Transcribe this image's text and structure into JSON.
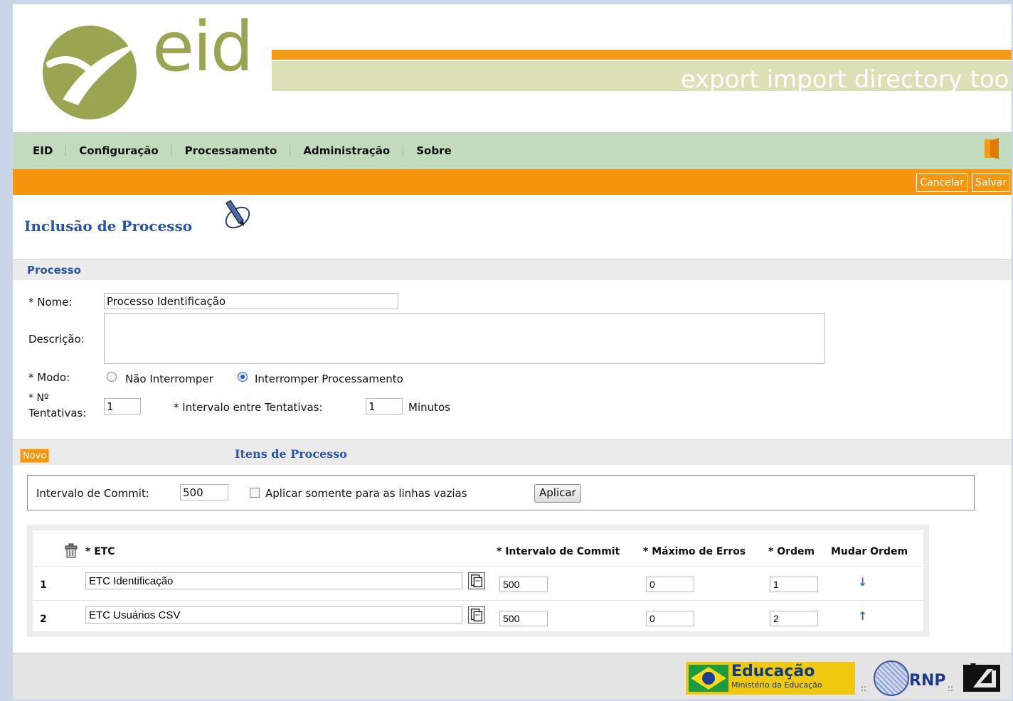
{
  "header": {
    "logo_text": "eid",
    "tagline": "export import directory tool"
  },
  "menu": {
    "items": [
      "EID",
      "Configuração",
      "Processamento",
      "Administração",
      "Sobre"
    ]
  },
  "actions": {
    "cancel_label": "Cancelar",
    "save_label": "Salvar"
  },
  "page": {
    "title": "Inclusão de Processo"
  },
  "processo_section": {
    "title": "Processo",
    "nome_label": "* Nome:",
    "nome_value": "Processo Identificação",
    "descricao_label": "Descrição:",
    "descricao_value": "",
    "modo_label": "* Modo:",
    "modo_options": [
      "Não Interromper",
      "Interromper Processamento"
    ],
    "modo_selected": "Interromper Processamento",
    "tentativas_label_1": "* Nº",
    "tentativas_label_2": "Tentativas:",
    "tentativas_value": "1",
    "intervalo_label": "* Intervalo entre Tentativas:",
    "intervalo_value": "1",
    "intervalo_unit": "Minutos"
  },
  "itens_section": {
    "novo_label": "Novo",
    "title": "Itens de Processo",
    "commit_label": "Intervalo de Commit:",
    "commit_value": "500",
    "empty_only_label": "Aplicar somente para as linhas vazias",
    "empty_only_checked": false,
    "apply_label": "Aplicar"
  },
  "table": {
    "headers": {
      "etc": "* ETC",
      "intervalo": "* Intervalo de Commit",
      "erros": "* Máximo de Erros",
      "ordem": "* Ordem",
      "mudar": "Mudar Ordem"
    },
    "rows": [
      {
        "num": "1",
        "etc": "ETC Identificação",
        "intervalo": "500",
        "erros": "0",
        "ordem": "1",
        "move": "down"
      },
      {
        "num": "2",
        "etc": "ETC Usuários CSV",
        "intervalo": "500",
        "erros": "0",
        "ordem": "2",
        "move": "up"
      }
    ]
  },
  "footer": {
    "mec_title": "Educação",
    "mec_subtitle": "Ministério da Educação",
    "rnp_text": "RNP",
    "separator": "::"
  },
  "colors": {
    "menu_bg": "#c2dbbc",
    "accent_orange": "#f6960f",
    "title_blue": "#2b56a5",
    "logo_olive": "#9aa552"
  }
}
